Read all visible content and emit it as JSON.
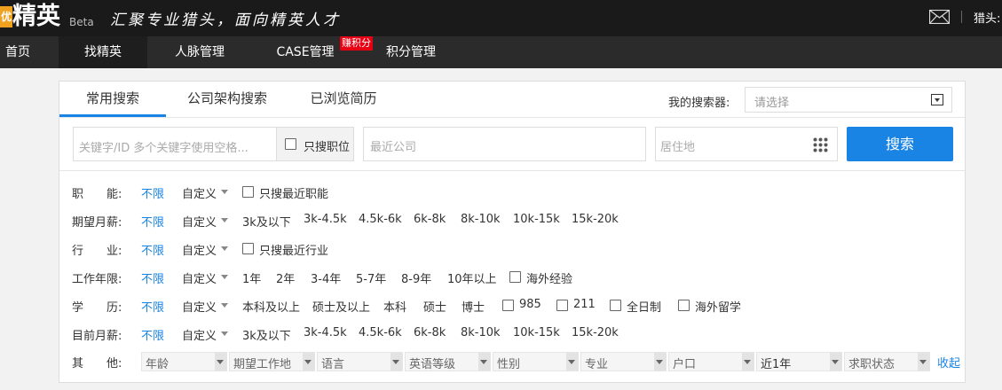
{
  "header": {
    "logo_badge": "优",
    "logo_text": "精英",
    "logo_beta": "Beta",
    "slogan": "汇聚专业猎头，面向精英人才",
    "user_label": "猎头:"
  },
  "nav": {
    "items": [
      "首页",
      "找精英",
      "人脉管理",
      "CASE管理",
      "积分管理"
    ],
    "badge": "赚积分"
  },
  "tabs": [
    "常用搜索",
    "公司架构搜索",
    "已浏览简历"
  ],
  "selector": {
    "label": "我的搜索器:",
    "placeholder": "请选择"
  },
  "search": {
    "keyword_placeholder": "关键字/ID 多个关键字使用空格...",
    "title_only_label": "只搜职位",
    "company_placeholder": "最近公司",
    "location_placeholder": "居住地",
    "button_label": "搜索"
  },
  "filters": {
    "unlimited": "不限",
    "custom": "自定义",
    "function": {
      "label": "职　　能:",
      "checkbox": "只搜最近职能"
    },
    "expected_salary": {
      "label": "期望月薪:",
      "options": [
        "3k及以下",
        "3k-4.5k",
        "4.5k-6k",
        "6k-8k",
        "8k-10k",
        "10k-15k",
        "15k-20k"
      ]
    },
    "industry": {
      "label": "行　　业:",
      "checkbox": "只搜最近行业"
    },
    "work_years": {
      "label": "工作年限:",
      "options": [
        "1年",
        "2年",
        "3-4年",
        "5-7年",
        "8-9年",
        "10年以上"
      ],
      "checkbox": "海外经验"
    },
    "education": {
      "label": "学　　历:",
      "options": [
        "本科及以上",
        "硕士及以上",
        "本科",
        "硕士",
        "博士"
      ],
      "checkboxes": [
        "985",
        "211",
        "全日制",
        "海外留学"
      ]
    },
    "current_salary": {
      "label": "目前月薪:",
      "options": [
        "3k及以下",
        "3k-4.5k",
        "4.5k-6k",
        "6k-8k",
        "8k-10k",
        "10k-15k",
        "15k-20k"
      ]
    },
    "other": {
      "label": "其　　他:",
      "selects": [
        "年龄",
        "期望工作地",
        "语言",
        "英语等级",
        "性别",
        "专业",
        "户口",
        "近1年",
        "求职状态"
      ],
      "collapse": "收起"
    }
  }
}
